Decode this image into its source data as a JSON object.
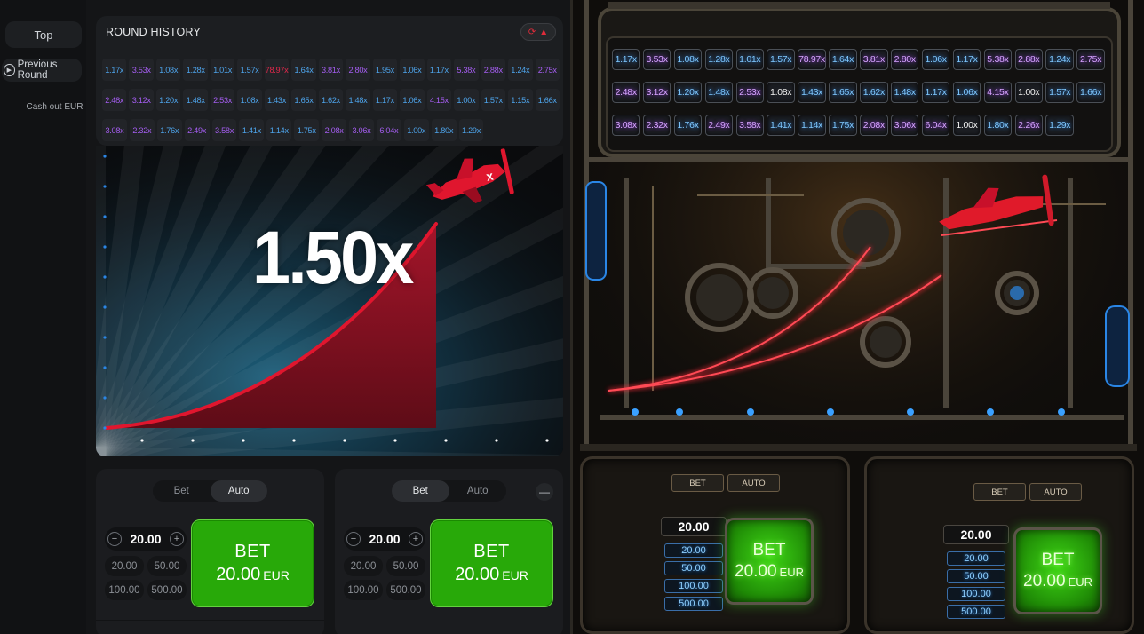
{
  "sidebar": {
    "top_label": "Top",
    "previous_round_label": "Previous Round",
    "cashout_label": "Cash out EUR"
  },
  "history": {
    "title": "ROUND HISTORY",
    "rows": [
      [
        {
          "v": "1.17x",
          "c": "blue"
        },
        {
          "v": "3.53x",
          "c": "purple"
        },
        {
          "v": "1.08x",
          "c": "blue"
        },
        {
          "v": "1.28x",
          "c": "blue"
        },
        {
          "v": "1.01x",
          "c": "blue"
        },
        {
          "v": "1.57x",
          "c": "blue"
        },
        {
          "v": "78.97x",
          "c": "red"
        },
        {
          "v": "1.64x",
          "c": "blue"
        },
        {
          "v": "3.81x",
          "c": "purple"
        },
        {
          "v": "2.80x",
          "c": "purple"
        },
        {
          "v": "1.95x",
          "c": "blue"
        },
        {
          "v": "1.06x",
          "c": "blue"
        },
        {
          "v": "1.17x",
          "c": "blue"
        },
        {
          "v": "5.38x",
          "c": "purple"
        },
        {
          "v": "2.88x",
          "c": "purple"
        },
        {
          "v": "1.24x",
          "c": "blue"
        },
        {
          "v": "2.75x",
          "c": "purple"
        }
      ],
      [
        {
          "v": "2.48x",
          "c": "purple"
        },
        {
          "v": "3.12x",
          "c": "purple"
        },
        {
          "v": "1.20x",
          "c": "blue"
        },
        {
          "v": "1.48x",
          "c": "blue"
        },
        {
          "v": "2.53x",
          "c": "purple"
        },
        {
          "v": "1.08x",
          "c": "blue"
        },
        {
          "v": "1.43x",
          "c": "blue"
        },
        {
          "v": "1.65x",
          "c": "blue"
        },
        {
          "v": "1.62x",
          "c": "blue"
        },
        {
          "v": "1.48x",
          "c": "blue"
        },
        {
          "v": "1.17x",
          "c": "blue"
        },
        {
          "v": "1.06x",
          "c": "blue"
        },
        {
          "v": "4.15x",
          "c": "purple"
        },
        {
          "v": "1.00x",
          "c": "blue"
        },
        {
          "v": "1.57x",
          "c": "blue"
        },
        {
          "v": "1.15x",
          "c": "blue"
        },
        {
          "v": "1.66x",
          "c": "blue"
        }
      ],
      [
        {
          "v": "3.08x",
          "c": "purple"
        },
        {
          "v": "2.32x",
          "c": "purple"
        },
        {
          "v": "1.76x",
          "c": "blue"
        },
        {
          "v": "2.49x",
          "c": "purple"
        },
        {
          "v": "3.58x",
          "c": "purple"
        },
        {
          "v": "1.41x",
          "c": "blue"
        },
        {
          "v": "1.14x",
          "c": "blue"
        },
        {
          "v": "1.75x",
          "c": "blue"
        },
        {
          "v": "2.08x",
          "c": "purple"
        },
        {
          "v": "3.06x",
          "c": "purple"
        },
        {
          "v": "6.04x",
          "c": "purple"
        },
        {
          "v": "1.00x",
          "c": "blue"
        },
        {
          "v": "1.80x",
          "c": "blue"
        },
        {
          "v": "1.29x",
          "c": "blue"
        }
      ]
    ]
  },
  "game": {
    "multiplier": "1.50x"
  },
  "bet_panels": [
    {
      "tabs": [
        "Bet",
        "Auto"
      ],
      "active_tab": "Auto",
      "amount": "20.00",
      "quick": [
        "20.00",
        "50.00",
        "100.00",
        "500.00"
      ],
      "bet_label": "BET",
      "bet_amount": "20.00",
      "currency": "EUR"
    },
    {
      "tabs": [
        "Bet",
        "Auto"
      ],
      "active_tab": "Bet",
      "amount": "20.00",
      "quick": [
        "20.00",
        "50.00",
        "100.00",
        "500.00"
      ],
      "bet_label": "BET",
      "bet_amount": "20.00",
      "currency": "EUR",
      "remove_symbol": "—"
    }
  ],
  "steampunk": {
    "rows": [
      [
        {
          "v": "1.17x",
          "c": "blue"
        },
        {
          "v": "3.53x",
          "c": "purple"
        },
        {
          "v": "1.08x",
          "c": "blue"
        },
        {
          "v": "1.28x",
          "c": "blue"
        },
        {
          "v": "1.01x",
          "c": "blue"
        },
        {
          "v": "1.57x",
          "c": "blue"
        },
        {
          "v": "78.97x",
          "c": "purple"
        },
        {
          "v": "1.64x",
          "c": "blue"
        },
        {
          "v": "3.81x",
          "c": "purple"
        },
        {
          "v": "2.80x",
          "c": "purple"
        },
        {
          "v": "1.06x",
          "c": "blue"
        },
        {
          "v": "1.17x",
          "c": "blue"
        },
        {
          "v": "5.38x",
          "c": "purple"
        },
        {
          "v": "2.88x",
          "c": "purple"
        },
        {
          "v": "1.24x",
          "c": "blue"
        },
        {
          "v": "2.75x",
          "c": "purple"
        }
      ],
      [
        {
          "v": "2.48x",
          "c": "purple"
        },
        {
          "v": "3.12x",
          "c": "purple"
        },
        {
          "v": "1.20x",
          "c": "blue"
        },
        {
          "v": "1.48x",
          "c": "blue"
        },
        {
          "v": "2.53x",
          "c": "purple"
        },
        {
          "v": "1.08x",
          "c": "white"
        },
        {
          "v": "1.43x",
          "c": "blue"
        },
        {
          "v": "1.65x",
          "c": "blue"
        },
        {
          "v": "1.62x",
          "c": "blue"
        },
        {
          "v": "1.48x",
          "c": "blue"
        },
        {
          "v": "1.17x",
          "c": "blue"
        },
        {
          "v": "1.06x",
          "c": "blue"
        },
        {
          "v": "4.15x",
          "c": "purple"
        },
        {
          "v": "1.00x",
          "c": "white"
        },
        {
          "v": "1.57x",
          "c": "blue"
        },
        {
          "v": "1.66x",
          "c": "blue"
        }
      ],
      [
        {
          "v": "3.08x",
          "c": "purple"
        },
        {
          "v": "2.32x",
          "c": "purple"
        },
        {
          "v": "1.76x",
          "c": "blue"
        },
        {
          "v": "2.49x",
          "c": "purple"
        },
        {
          "v": "3.58x",
          "c": "purple"
        },
        {
          "v": "1.41x",
          "c": "blue"
        },
        {
          "v": "1.14x",
          "c": "blue"
        },
        {
          "v": "1.75x",
          "c": "blue"
        },
        {
          "v": "2.08x",
          "c": "purple"
        },
        {
          "v": "3.06x",
          "c": "purple"
        },
        {
          "v": "6.04x",
          "c": "purple"
        },
        {
          "v": "1.00x",
          "c": "white"
        },
        {
          "v": "1.80x",
          "c": "blue"
        },
        {
          "v": "2.26x",
          "c": "purple"
        },
        {
          "v": "1.29x",
          "c": "blue"
        }
      ]
    ],
    "panels": [
      {
        "tabs": [
          "BET",
          "AUTO"
        ],
        "amount": "20.00",
        "quick": [
          "20.00",
          "50.00",
          "100.00",
          "500.00"
        ],
        "bet_label": "BET",
        "bet_amount": "20.00",
        "currency": "EUR"
      },
      {
        "tabs": [
          "BET",
          "AUTO"
        ],
        "amount": "20.00",
        "quick": [
          "20.00",
          "50.00",
          "100.00",
          "500.00"
        ],
        "bet_label": "BET",
        "bet_amount": "20.00",
        "currency": "EUR"
      }
    ]
  },
  "colors": {
    "blue": "#4da3ea",
    "purple": "#a45df0",
    "red": "#e0284b",
    "bet_green": "#28a909",
    "curve_red": "#e0162e"
  },
  "icons": {
    "play": "play-circle-icon",
    "history_toggle": "history-toggle-icon",
    "plane": "plane-icon",
    "minus": "minus-icon",
    "plus": "plus-icon"
  }
}
